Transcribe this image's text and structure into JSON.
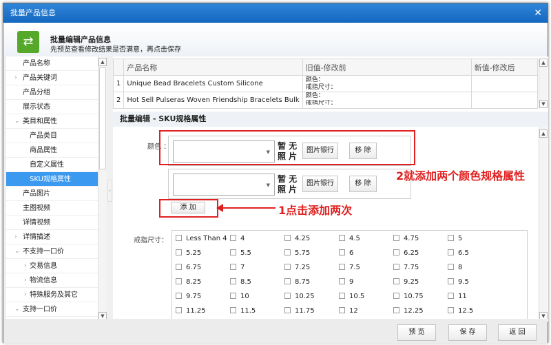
{
  "window": {
    "title": "批量产品信息",
    "close": "✕"
  },
  "header": {
    "title": "批量编辑产品信息",
    "subtitle": "先预览查看修改结果是否满意，再点击保存",
    "icon": "swap-icon"
  },
  "sidebar": {
    "items": [
      {
        "label": "产品名称",
        "arrow": "",
        "indent": 0
      },
      {
        "label": "产品关键词",
        "arrow": "›",
        "indent": 0
      },
      {
        "label": "产品分组",
        "arrow": "",
        "indent": 0
      },
      {
        "label": "展示状态",
        "arrow": "",
        "indent": 0
      },
      {
        "label": "类目和属性",
        "arrow": "⌄",
        "indent": 0
      },
      {
        "label": "产品类目",
        "arrow": "",
        "indent": 1
      },
      {
        "label": "商品属性",
        "arrow": "",
        "indent": 1
      },
      {
        "label": "自定义属性",
        "arrow": "",
        "indent": 1
      },
      {
        "label": "SKU规格属性",
        "arrow": "",
        "indent": 1,
        "selected": true
      },
      {
        "label": "产品图片",
        "arrow": "",
        "indent": 0
      },
      {
        "label": "主图视频",
        "arrow": "",
        "indent": 0
      },
      {
        "label": "详情视频",
        "arrow": "",
        "indent": 0
      },
      {
        "label": "详情描述",
        "arrow": "›",
        "indent": 0
      },
      {
        "label": "不支持一口价",
        "arrow": "⌄",
        "indent": 0
      },
      {
        "label": "交易信息",
        "arrow": "›",
        "indent": 1
      },
      {
        "label": "物流信息",
        "arrow": "›",
        "indent": 1
      },
      {
        "label": "特殊服务及其它",
        "arrow": "›",
        "indent": 1
      },
      {
        "label": "支持一口价",
        "arrow": "⌄",
        "indent": 0
      }
    ]
  },
  "table": {
    "headers": [
      "产品名称",
      "旧值-修改前",
      "新值-修改后"
    ],
    "rows": [
      {
        "n": "1",
        "name": "Unique Bead Bracelets Custom Silicone",
        "old": [
          "颜色：",
          "戒指尺寸："
        ]
      },
      {
        "n": "2",
        "name": "Hot Sell Pulseras Woven Friendship Bracelets Bulk",
        "old": [
          "颜色：",
          "戒指尺寸："
        ]
      }
    ]
  },
  "section": {
    "title": "批量编辑 - SKU规格属性",
    "color_label": "颜色 ：",
    "size_label": "戒指尺寸：",
    "no_photo": "暂 无 照 片",
    "image_bank": "图片银行",
    "remove": "移 除",
    "add": "添 加"
  },
  "annotations": {
    "a1": "1点击添加两次",
    "a2": "2就添加两个颜色规格属性",
    "color": "#e02020"
  },
  "sizes": [
    "Less Than 4",
    "4",
    "4.25",
    "4.5",
    "4.75",
    "5",
    "5.25",
    "5.5",
    "5.75",
    "6",
    "6.25",
    "6.5",
    "6.75",
    "7",
    "7.25",
    "7.5",
    "7.75",
    "8",
    "8.25",
    "8.5",
    "8.75",
    "9",
    "9.25",
    "9.5",
    "9.75",
    "10",
    "10.25",
    "10.5",
    "10.75",
    "11",
    "11.25",
    "11.5",
    "11.75",
    "12",
    "12.25",
    "12.5"
  ],
  "footer": {
    "preview": "预 览",
    "save": "保 存",
    "back": "返 回"
  }
}
